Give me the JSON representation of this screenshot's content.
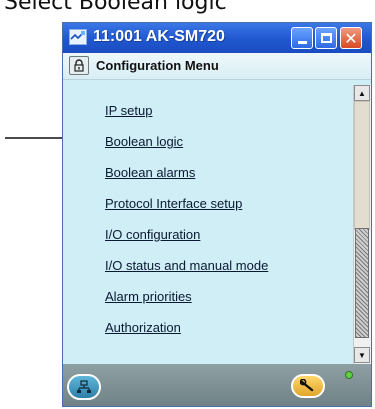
{
  "caption": "Select Boolean logic",
  "window": {
    "title": "11:001 AK-SM720",
    "min_label": "",
    "max_label": "",
    "close_label": "✕"
  },
  "menu": {
    "title": "Configuration Menu",
    "items": [
      {
        "label": "IP setup"
      },
      {
        "label": "Boolean logic"
      },
      {
        "label": "Boolean alarms"
      },
      {
        "label": "Protocol Interface setup"
      },
      {
        "label": "I/O configuration"
      },
      {
        "label": "I/O status and manual mode"
      },
      {
        "label": "Alarm priorities"
      },
      {
        "label": "Authorization"
      }
    ]
  },
  "scrollbar": {
    "up_glyph": "▲",
    "down_glyph": "▼"
  },
  "icons": {
    "app": "network-monitor-icon",
    "lock": "lock-icon",
    "network": "network-tree-icon",
    "wrench": "wrench-icon",
    "pointer": "arrow-pointer"
  },
  "colors": {
    "titlebar": "#2a63d9",
    "content_bg": "#cfeef6",
    "close_button": "#d84a24",
    "status_led": "#60d040"
  }
}
